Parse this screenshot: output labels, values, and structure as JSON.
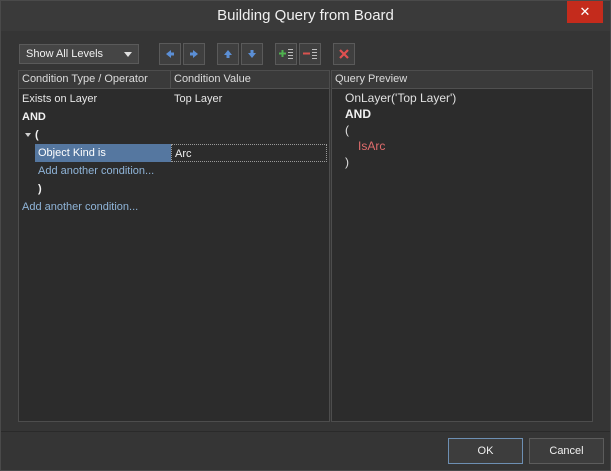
{
  "window": {
    "title": "Building Query from Board",
    "close_glyph": "✕"
  },
  "toolbar": {
    "level_select_value": "Show All Levels",
    "buttons": [
      {
        "name": "move-left-icon",
        "color": "#5b8fd6"
      },
      {
        "name": "move-right-icon",
        "color": "#5b8fd6"
      },
      {
        "name": "move-up-icon",
        "color": "#5b8fd6"
      },
      {
        "name": "move-down-icon",
        "color": "#5b8fd6"
      },
      {
        "name": "add-condition-icon",
        "color": "#4fb24f"
      },
      {
        "name": "remove-condition-icon",
        "color": "#d9534f"
      },
      {
        "name": "clear-icon",
        "color": "#e05050"
      }
    ]
  },
  "grid": {
    "col_condition": "Condition Type / Operator",
    "col_value": "Condition Value",
    "rows": {
      "exists_on_layer": "Exists on Layer",
      "exists_on_layer_value": "Top Layer",
      "and_op": "AND",
      "open_paren": "(",
      "object_kind": "Object Kind is",
      "object_kind_value": "Arc",
      "add_inner": "Add another condition...",
      "close_paren": ")",
      "add_outer": "Add another condition..."
    }
  },
  "preview": {
    "header": "Query Preview",
    "line1": "OnLayer('Top Layer')",
    "line2": "AND",
    "line3": "(",
    "line4": "IsArc",
    "line5": ")"
  },
  "footer": {
    "ok_label": "OK",
    "cancel_label": "Cancel"
  },
  "colors": {
    "selection": "#5577a0",
    "link": "#8fb4d8",
    "preview_error": "#e06c6c",
    "close_button": "#c42b1c"
  }
}
